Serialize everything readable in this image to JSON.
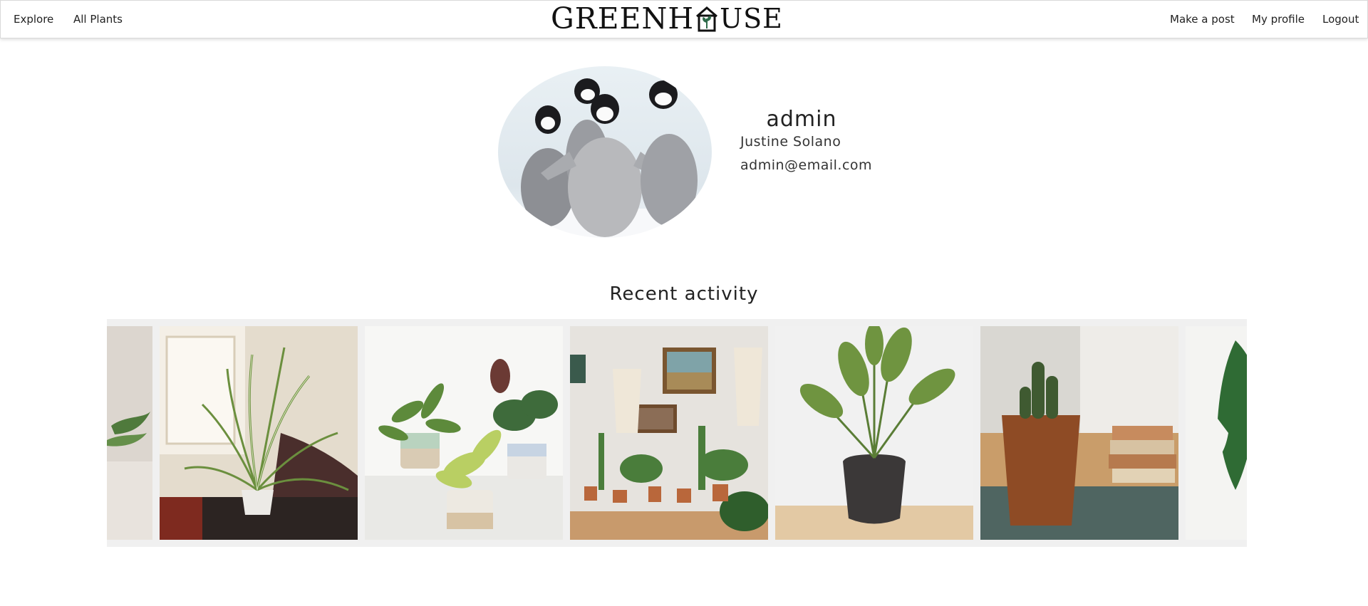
{
  "nav": {
    "explore": "Explore",
    "all_plants": "All Plants",
    "make_post": "Make a post",
    "my_profile": "My profile",
    "logout": "Logout"
  },
  "logo": {
    "part1": "GREENH",
    "part2": "USE",
    "icon": "house-leaf-icon",
    "accent_color": "#2e6b4a"
  },
  "profile": {
    "avatar": "penguin-chicks-photo",
    "username": "admin",
    "full_name": "Justine Solano",
    "email": "admin@email.com"
  },
  "recent_activity": {
    "title": "Recent activity",
    "posts": [
      {
        "image": "plant-partial-left"
      },
      {
        "image": "spider-plant"
      },
      {
        "image": "potted-plants-trio"
      },
      {
        "image": "plant-shelf-wall"
      },
      {
        "image": "bird-of-paradise"
      },
      {
        "image": "cactus-terracotta"
      },
      {
        "image": "monstera-partial-right"
      }
    ]
  }
}
